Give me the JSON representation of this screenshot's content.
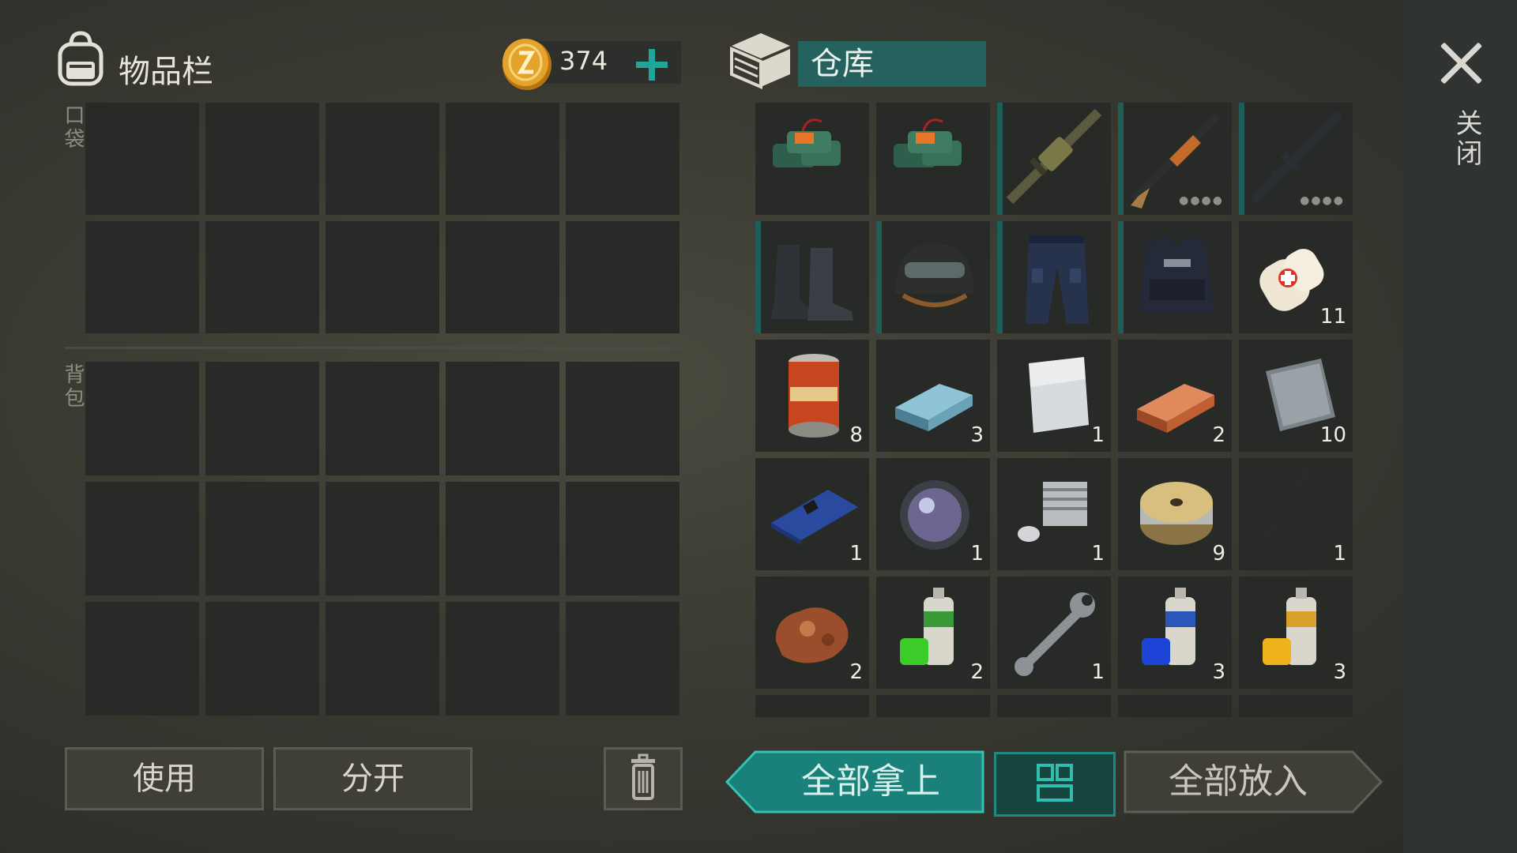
{
  "inventory": {
    "title": "物品栏",
    "coins": "374",
    "pocket_label": "口袋",
    "backpack_label": "背包"
  },
  "storage": {
    "title": "仓库"
  },
  "close": {
    "label": "关闭"
  },
  "storage_items": [
    {
      "name": "c4-explosive",
      "qty": "",
      "equip": false,
      "dots": false
    },
    {
      "name": "c4-explosive",
      "qty": "",
      "equip": false,
      "dots": false
    },
    {
      "name": "grenade-launcher-rifle",
      "qty": "",
      "equip": true,
      "dots": false
    },
    {
      "name": "pump-shotgun",
      "qty": "",
      "equip": true,
      "dots": true
    },
    {
      "name": "assault-rifle",
      "qty": "",
      "equip": true,
      "dots": true
    },
    {
      "name": "combat-boots",
      "qty": "",
      "equip": true,
      "dots": false
    },
    {
      "name": "tactical-helmet",
      "qty": "",
      "equip": true,
      "dots": false
    },
    {
      "name": "tactical-pants",
      "qty": "",
      "equip": true,
      "dots": false
    },
    {
      "name": "police-vest",
      "qty": "",
      "equip": true,
      "dots": false
    },
    {
      "name": "bandage",
      "qty": "11",
      "equip": false,
      "dots": false
    },
    {
      "name": "canned-food",
      "qty": "8",
      "equip": false,
      "dots": false
    },
    {
      "name": "steel-bar",
      "qty": "3",
      "equip": false,
      "dots": false
    },
    {
      "name": "aluminum-plate",
      "qty": "1",
      "equip": false,
      "dots": false
    },
    {
      "name": "copper-bar",
      "qty": "2",
      "equip": false,
      "dots": false
    },
    {
      "name": "iron-plate",
      "qty": "10",
      "equip": false,
      "dots": false
    },
    {
      "name": "circuit-board",
      "qty": "1",
      "equip": false,
      "dots": false
    },
    {
      "name": "lens",
      "qty": "1",
      "equip": false,
      "dots": false
    },
    {
      "name": "engine-cylinder",
      "qty": "1",
      "equip": false,
      "dots": false
    },
    {
      "name": "wire-spool",
      "qty": "9",
      "equip": false,
      "dots": false
    },
    {
      "name": "spring",
      "qty": "1",
      "equip": false,
      "dots": false
    },
    {
      "name": "copper-ore",
      "qty": "2",
      "equip": false,
      "dots": false
    },
    {
      "name": "green-spray-paint",
      "qty": "2",
      "equip": false,
      "dots": false
    },
    {
      "name": "wrench",
      "qty": "1",
      "equip": false,
      "dots": false
    },
    {
      "name": "blue-spray-paint",
      "qty": "3",
      "equip": false,
      "dots": false
    },
    {
      "name": "yellow-spray-paint",
      "qty": "3",
      "equip": false,
      "dots": false
    }
  ],
  "buttons": {
    "use": "使用",
    "split": "分开",
    "take_all": "全部拿上",
    "put_all": "全部放入"
  },
  "colors": {
    "accent_teal": "#1fa69a",
    "storage_tab": "#25625e",
    "cell": "#272a27",
    "coin": "#e4a32b"
  }
}
